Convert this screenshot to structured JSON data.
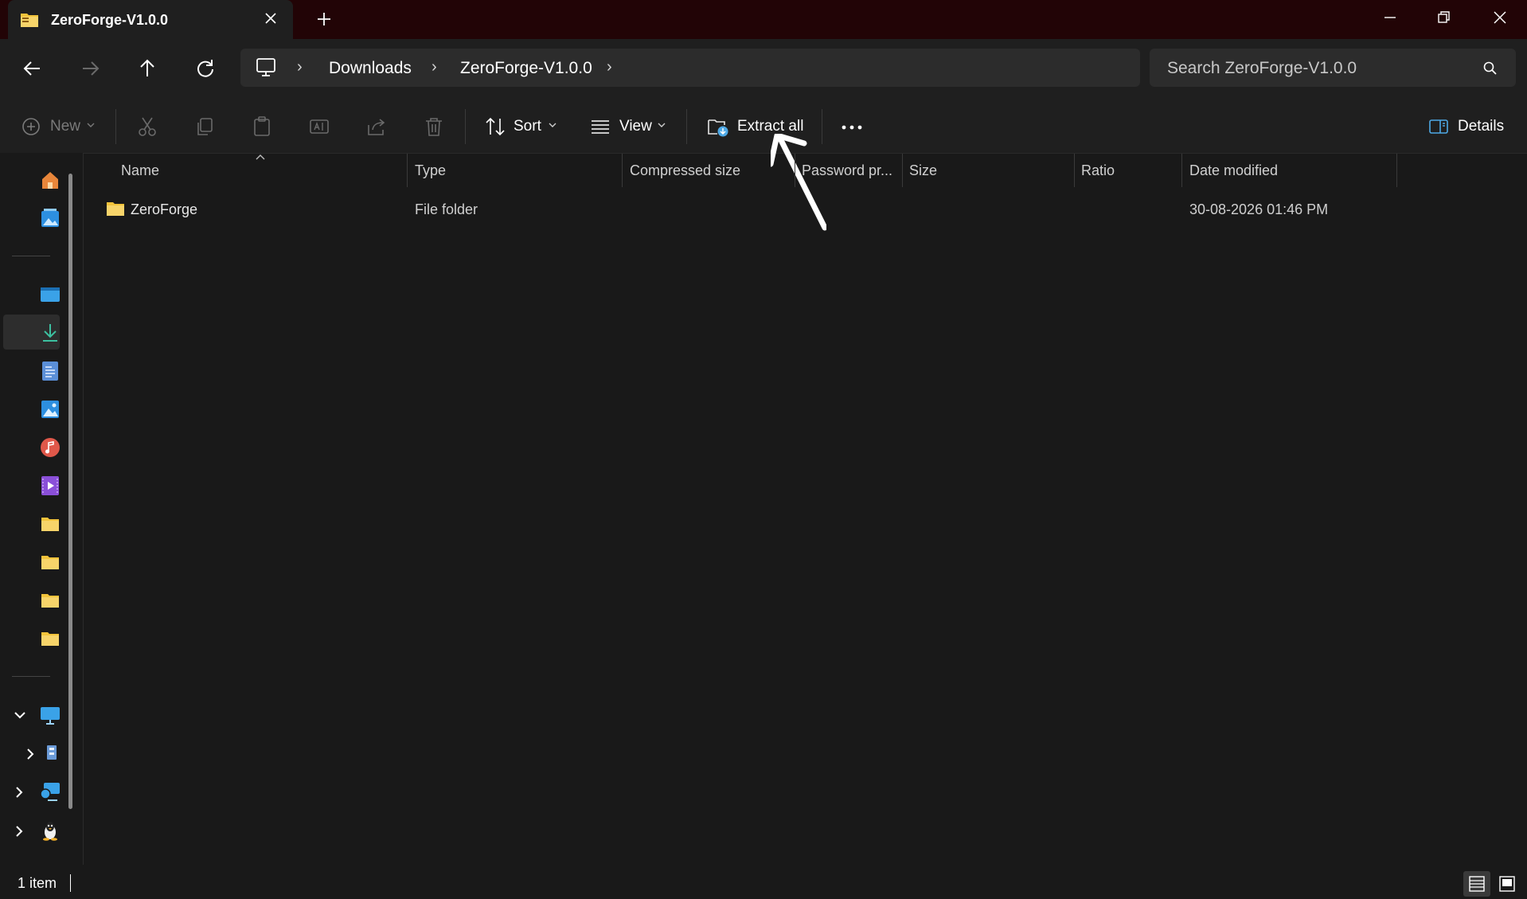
{
  "window": {
    "tab_title": "ZeroForge-V1.0.0"
  },
  "address": {
    "crumbs": [
      "Downloads",
      "ZeroForge-V1.0.0"
    ]
  },
  "search": {
    "placeholder": "Search ZeroForge-V1.0.0"
  },
  "toolbar": {
    "new_label": "New",
    "sort_label": "Sort",
    "view_label": "View",
    "extract_label": "Extract all",
    "details_label": "Details"
  },
  "columns": [
    "Name",
    "Type",
    "Compressed size",
    "Password pr...",
    "Size",
    "Ratio",
    "Date modified"
  ],
  "rows": [
    {
      "name": "ZeroForge",
      "type": "File folder",
      "compressed_size": "",
      "password": "",
      "size": "",
      "ratio": "",
      "date_modified": "30-08-2026 01:46 PM"
    }
  ],
  "status": {
    "item_count": "1 item"
  },
  "colors": {
    "titlebar": "#220406",
    "folder": "#f2c33b",
    "accent": "#4ea9e6"
  }
}
